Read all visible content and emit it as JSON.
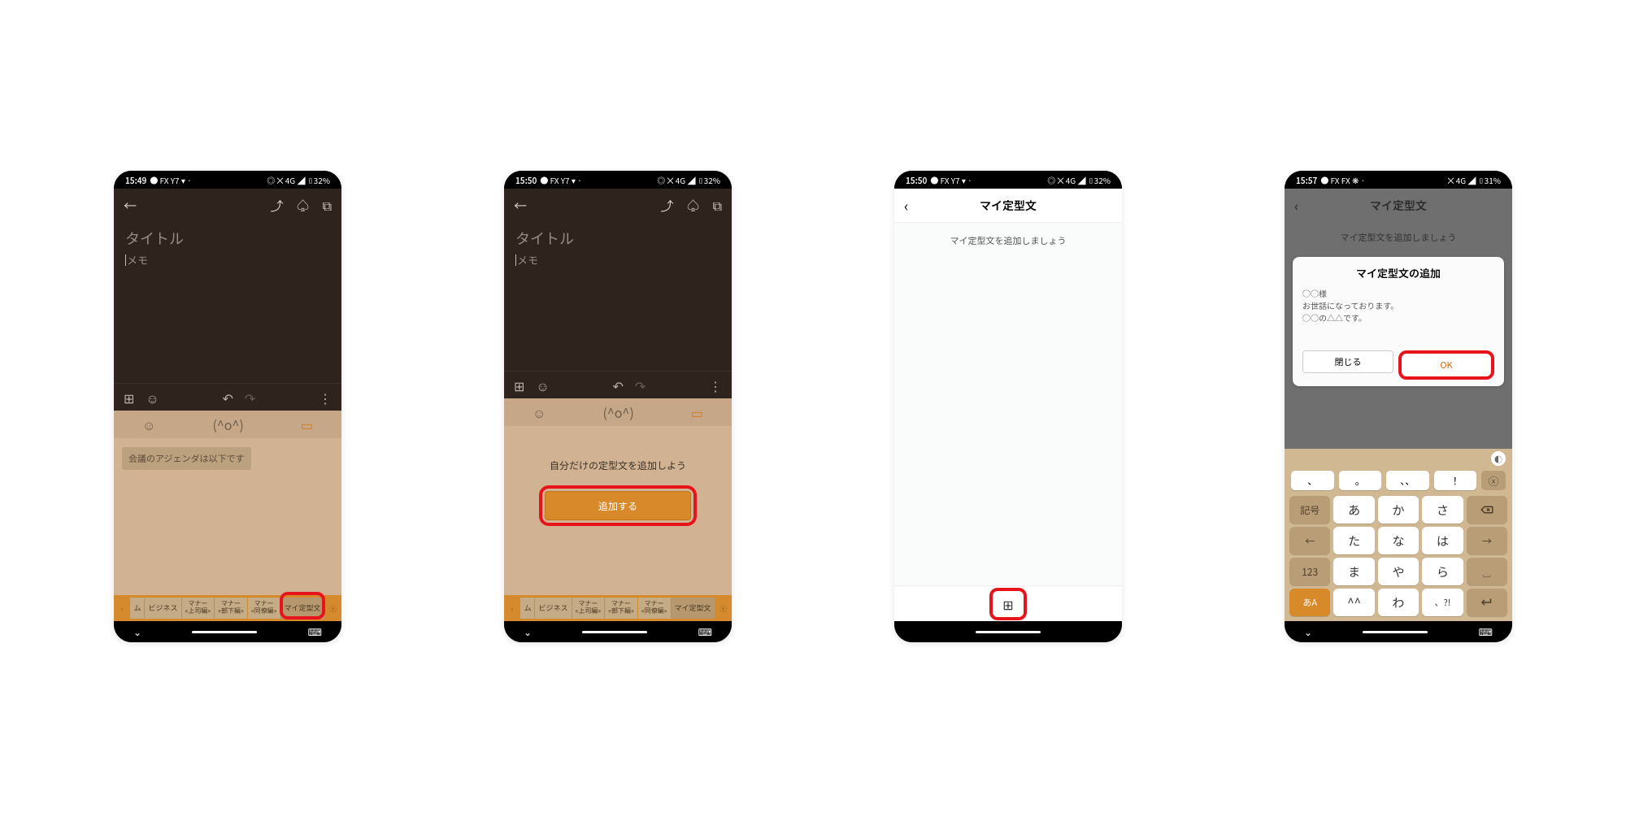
{
  "screens": {
    "s1": {
      "status": {
        "time": "15:49",
        "icons_left": "● FX Y7 ▾ ·",
        "icons_right": "◎ ⨉ 4G ◢ ▯32%"
      },
      "title_placeholder": "タイトル",
      "memo_placeholder": "メモ",
      "suggestion": "会議のアジェンダは以下です",
      "tabs": [
        "ム",
        "ビジネス",
        "マナー\n«上司編»",
        "マナー\n«部下編»",
        "マナー\n«同僚編»",
        "マイ定型文"
      ]
    },
    "s2": {
      "status": {
        "time": "15:50",
        "icons_left": "● FX Y7 ▾ ·",
        "icons_right": "◎ ⨉ 4G ◢ ▯32%"
      },
      "title_placeholder": "タイトル",
      "memo_placeholder": "メモ",
      "add_heading": "自分だけの定型文を追加しよう",
      "add_button": "追加する",
      "tabs": [
        "ム",
        "ビジネス",
        "マナー\n«上司編»",
        "マナー\n«部下編»",
        "マナー\n«同僚編»",
        "マイ定型文"
      ]
    },
    "s3": {
      "status": {
        "time": "15:50",
        "icons_left": "● FX Y7 ▾ ·",
        "icons_right": "◎ ⨉ 4G ◢ ▯32%"
      },
      "title": "マイ定型文",
      "subtitle": "マイ定型文を追加しましょう",
      "plus": "⊞"
    },
    "s4": {
      "status": {
        "time": "15:57",
        "icons_left": "● FX FX ❋ ·",
        "icons_right": "⨉ 4G ◢ ▯31%"
      },
      "title": "マイ定型文",
      "subtitle": "マイ定型文を追加しましょう",
      "dialog_title": "マイ定型文の追加",
      "dialog_text": "○○様\nお世話になっております。\n○○の△△です。",
      "close": "閉じる",
      "ok": "OK",
      "punct": [
        "、",
        "。",
        "、、",
        "！"
      ],
      "rows": [
        [
          "記号",
          "あ",
          "か",
          "さ",
          "⌫"
        ],
        [
          "←",
          "た",
          "な",
          "は",
          "→"
        ],
        [
          "123",
          "ま",
          "や",
          "ら",
          "sp"
        ],
        [
          "あA",
          "^^",
          "わ",
          "、?!",
          "ret"
        ]
      ]
    }
  }
}
